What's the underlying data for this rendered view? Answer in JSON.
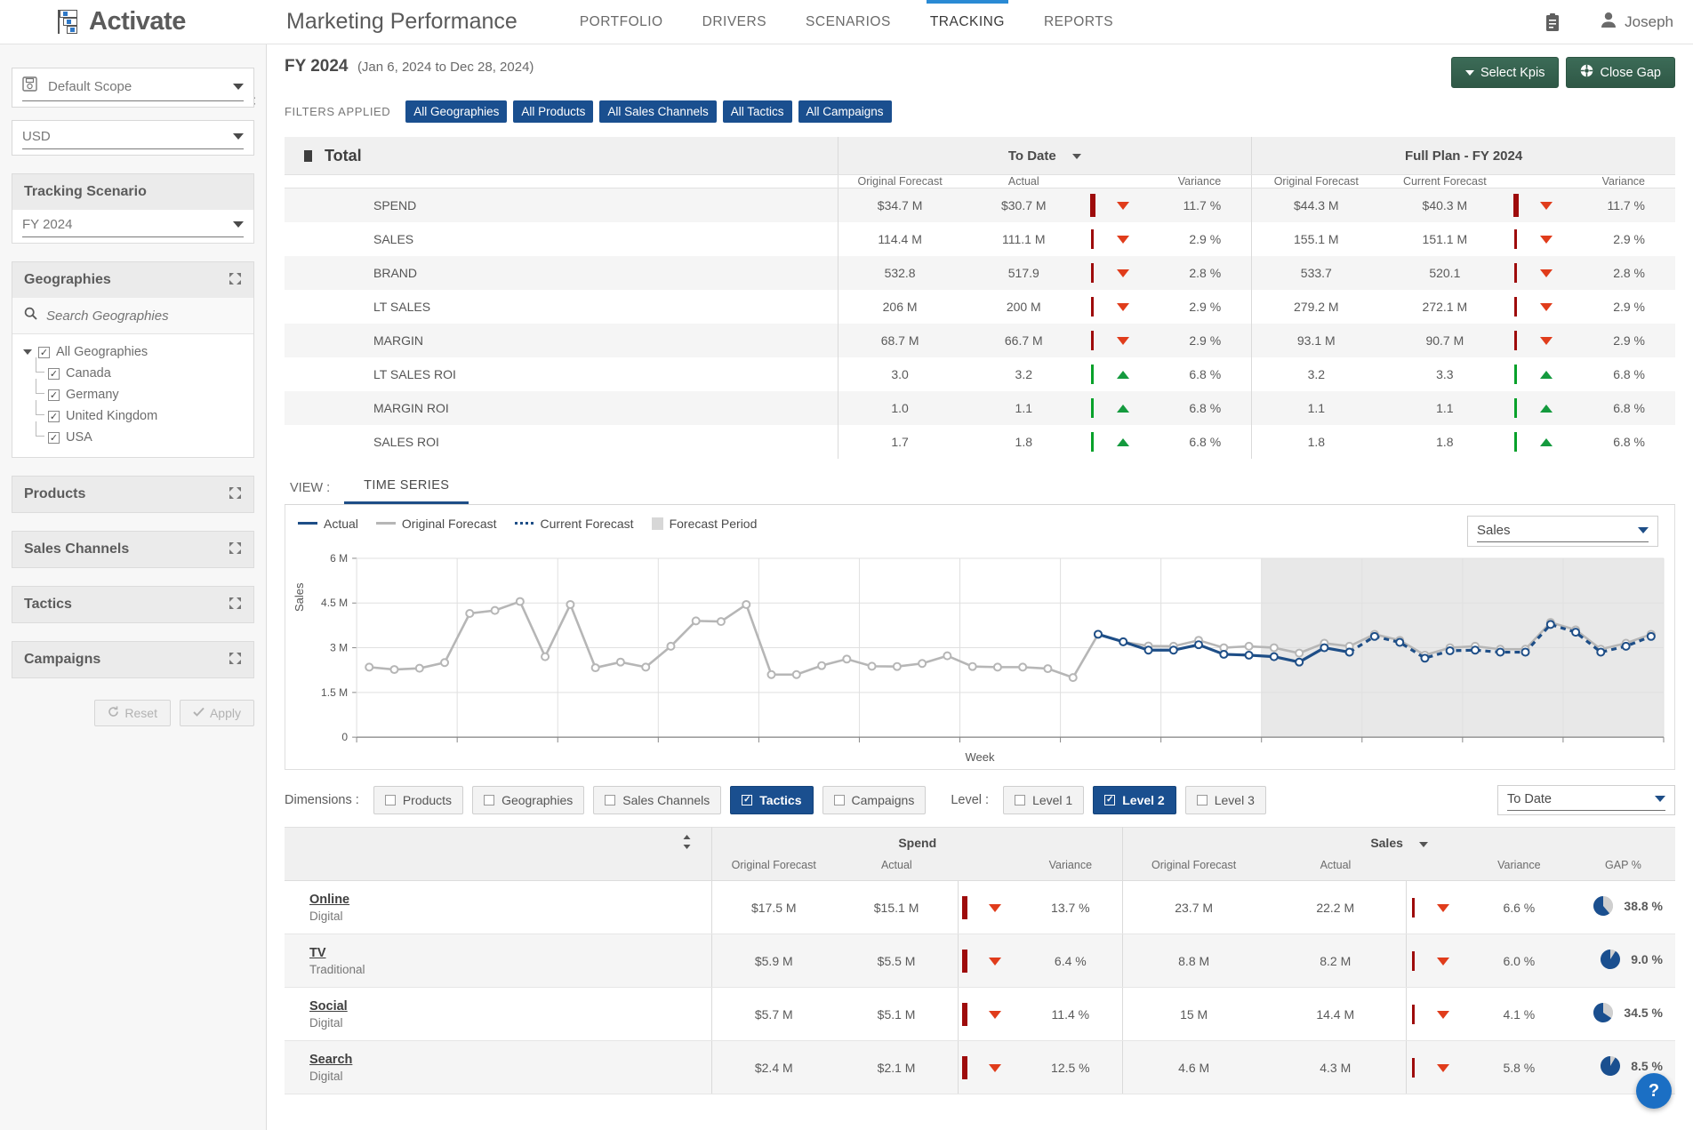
{
  "header": {
    "brand": "Activate",
    "app_title": "Marketing Performance",
    "nav": [
      {
        "label": "PORTFOLIO",
        "active": false
      },
      {
        "label": "DRIVERS",
        "active": false
      },
      {
        "label": "SCENARIOS",
        "active": false
      },
      {
        "label": "TRACKING",
        "active": true
      },
      {
        "label": "REPORTS",
        "active": false
      }
    ],
    "clipboard_icon": "clipboard-icon",
    "user_name": "Joseph",
    "user_icon": "user-icon"
  },
  "sidebar": {
    "close_icon": "close-icon",
    "scope": {
      "icon": "save-icon",
      "value": "Default Scope"
    },
    "currency": {
      "value": "USD"
    },
    "tracking_scenario": {
      "title": "Tracking Scenario",
      "value": "FY 2024"
    },
    "geographies": {
      "title": "Geographies",
      "search_placeholder": "Search Geographies",
      "root": "All Geographies",
      "children": [
        "Canada",
        "Germany",
        "United Kingdom",
        "USA"
      ]
    },
    "panels": [
      "Products",
      "Sales Channels",
      "Tactics",
      "Campaigns"
    ],
    "reset_label": "Reset",
    "apply_label": "Apply"
  },
  "page": {
    "title": "FY 2024",
    "subtitle": "(Jan 6, 2024 to Dec 28, 2024)",
    "select_kpis_label": "Select Kpis",
    "close_gap_label": "Close Gap",
    "filters_label": "FILTERS APPLIED",
    "filter_chips": [
      "All Geographies",
      "All Products",
      "All Sales Channels",
      "All Tactics",
      "All Campaigns"
    ]
  },
  "kpi_table": {
    "total_label": "Total",
    "group_to_date": "To Date",
    "group_full_plan": "Full Plan - FY 2024",
    "sub_headers": {
      "original_forecast": "Original Forecast",
      "actual": "Actual",
      "current_forecast": "Current Forecast",
      "variance": "Variance"
    },
    "rows": [
      {
        "name": "SPEND",
        "td_of": "$34.7 M",
        "td_actual": "$30.7 M",
        "td_var": "11.7 %",
        "td_dir": "down",
        "td_bar": "big",
        "fp_of": "$44.3 M",
        "fp_cf": "$40.3 M",
        "fp_var": "11.7 %",
        "fp_dir": "down",
        "fp_bar": "big"
      },
      {
        "name": "SALES",
        "td_of": "114.4 M",
        "td_actual": "111.1 M",
        "td_var": "2.9 %",
        "td_dir": "down",
        "td_bar": "small",
        "fp_of": "155.1 M",
        "fp_cf": "151.1 M",
        "fp_var": "2.9 %",
        "fp_dir": "down",
        "fp_bar": "small"
      },
      {
        "name": "BRAND",
        "td_of": "532.8",
        "td_actual": "517.9",
        "td_var": "2.8 %",
        "td_dir": "down",
        "td_bar": "small",
        "fp_of": "533.7",
        "fp_cf": "520.1",
        "fp_var": "2.8 %",
        "fp_dir": "down",
        "fp_bar": "small"
      },
      {
        "name": "LT SALES",
        "td_of": "206 M",
        "td_actual": "200 M",
        "td_var": "2.9 %",
        "td_dir": "down",
        "td_bar": "small",
        "fp_of": "279.2 M",
        "fp_cf": "272.1 M",
        "fp_var": "2.9 %",
        "fp_dir": "down",
        "fp_bar": "small"
      },
      {
        "name": "MARGIN",
        "td_of": "68.7 M",
        "td_actual": "66.7 M",
        "td_var": "2.9 %",
        "td_dir": "down",
        "td_bar": "small",
        "fp_of": "93.1 M",
        "fp_cf": "90.7 M",
        "fp_var": "2.9 %",
        "fp_dir": "down",
        "fp_bar": "small"
      },
      {
        "name": "LT SALES ROI",
        "td_of": "3.0",
        "td_actual": "3.2",
        "td_var": "6.8 %",
        "td_dir": "up",
        "td_bar": "mid",
        "fp_of": "3.2",
        "fp_cf": "3.3",
        "fp_var": "6.8 %",
        "fp_dir": "up",
        "fp_bar": "mid"
      },
      {
        "name": "MARGIN ROI",
        "td_of": "1.0",
        "td_actual": "1.1",
        "td_var": "6.8 %",
        "td_dir": "up",
        "td_bar": "mid",
        "fp_of": "1.1",
        "fp_cf": "1.1",
        "fp_var": "6.8 %",
        "fp_dir": "up",
        "fp_bar": "mid"
      },
      {
        "name": "SALES ROI",
        "td_of": "1.7",
        "td_actual": "1.8",
        "td_var": "6.8 %",
        "td_dir": "up",
        "td_bar": "mid",
        "fp_of": "1.8",
        "fp_cf": "1.8",
        "fp_var": "6.8 %",
        "fp_dir": "up",
        "fp_bar": "mid"
      }
    ]
  },
  "view": {
    "label": "VIEW :",
    "tab": "TIME SERIES",
    "kpi_selector_value": "Sales"
  },
  "chart_data": {
    "type": "line",
    "title": "",
    "xlabel": "Week",
    "ylabel": "Sales",
    "ylim": [
      0,
      6000000
    ],
    "ytick_labels": [
      "0",
      "1.5 M",
      "3 M",
      "4.5 M",
      "6 M"
    ],
    "ytick_values": [
      0,
      1500000,
      3000000,
      4500000,
      6000000
    ],
    "grid": true,
    "legend_position": "top-left",
    "forecast_period_start_index": 36,
    "legend": [
      {
        "name": "Actual",
        "color": "#1e4e87",
        "style": "solid"
      },
      {
        "name": "Original Forecast",
        "color": "#b6b6b6",
        "style": "solid"
      },
      {
        "name": "Current Forecast",
        "color": "#1e4e87",
        "style": "dotted"
      },
      {
        "name": "Forecast Period",
        "color": "#d7d7d7",
        "style": "band"
      }
    ],
    "x": [
      1,
      2,
      3,
      4,
      5,
      6,
      7,
      8,
      9,
      10,
      11,
      12,
      13,
      14,
      15,
      16,
      17,
      18,
      19,
      20,
      21,
      22,
      23,
      24,
      25,
      26,
      27,
      28,
      29,
      30,
      31,
      32,
      33,
      34,
      35,
      36,
      37,
      38,
      39,
      40,
      41,
      42,
      43,
      44,
      45,
      46,
      47,
      48,
      49,
      50,
      51,
      52
    ],
    "series": [
      {
        "name": "Original Forecast",
        "color": "#b6b6b6",
        "style": "solid",
        "values": [
          2.35,
          2.27,
          2.31,
          2.5,
          4.15,
          4.25,
          4.55,
          2.7,
          4.45,
          2.33,
          2.52,
          2.35,
          3.05,
          3.9,
          3.88,
          4.45,
          2.1,
          2.1,
          2.4,
          2.62,
          2.38,
          2.37,
          2.47,
          2.73,
          2.37,
          2.35,
          2.35,
          2.3,
          2.0,
          3.45,
          3.2,
          3.06,
          3.05,
          3.25,
          3.0,
          3.05,
          3.0,
          2.82,
          3.15,
          3.05,
          3.45,
          3.25,
          2.75,
          3.0,
          3.05,
          2.95,
          2.95,
          3.85,
          3.6,
          2.95,
          3.15,
          3.45
        ]
      },
      {
        "name": "Actual",
        "color": "#1e4e87",
        "style": "solid",
        "start_index": 29,
        "values": [
          null,
          null,
          null,
          null,
          null,
          null,
          null,
          null,
          null,
          null,
          null,
          null,
          null,
          null,
          null,
          null,
          null,
          null,
          null,
          null,
          null,
          null,
          null,
          null,
          null,
          null,
          null,
          null,
          null,
          3.45,
          3.2,
          2.92,
          2.92,
          3.1,
          2.78,
          2.75,
          2.7,
          2.52,
          3.0,
          2.85,
          null,
          null,
          null,
          null,
          null,
          null,
          null,
          null,
          null,
          null,
          null,
          null
        ]
      },
      {
        "name": "Current Forecast",
        "color": "#1e4e87",
        "style": "dotted",
        "start_index": 40,
        "values": [
          null,
          null,
          null,
          null,
          null,
          null,
          null,
          null,
          null,
          null,
          null,
          null,
          null,
          null,
          null,
          null,
          null,
          null,
          null,
          null,
          null,
          null,
          null,
          null,
          null,
          null,
          null,
          null,
          null,
          null,
          null,
          null,
          null,
          null,
          null,
          null,
          null,
          null,
          null,
          2.85,
          3.38,
          3.18,
          2.65,
          2.9,
          2.92,
          2.85,
          2.85,
          3.78,
          3.52,
          2.85,
          3.05,
          3.38
        ]
      }
    ]
  },
  "dimensions": {
    "label": "Dimensions :",
    "options": [
      {
        "label": "Products",
        "checked": false
      },
      {
        "label": "Geographies",
        "checked": false
      },
      {
        "label": "Sales Channels",
        "checked": false
      },
      {
        "label": "Tactics",
        "checked": true
      },
      {
        "label": "Campaigns",
        "checked": false
      }
    ],
    "level_label": "Level :",
    "levels": [
      {
        "label": "Level 1",
        "checked": false
      },
      {
        "label": "Level 2",
        "checked": true
      },
      {
        "label": "Level 3",
        "checked": false
      }
    ],
    "period_selector_value": "To Date"
  },
  "dim_table": {
    "group_spend": "Spend",
    "group_sales": "Sales",
    "sub_headers": {
      "original_forecast": "Original Forecast",
      "actual": "Actual",
      "variance": "Variance",
      "gap": "GAP %"
    },
    "rows": [
      {
        "name": "Online",
        "sub": "Digital",
        "sp_of": "$17.5 M",
        "sp_actual": "$15.1 M",
        "sp_var": "13.7 %",
        "sp_dir": "down",
        "sa_of": "23.7 M",
        "sa_actual": "22.2 M",
        "sa_var": "6.6 %",
        "sa_dir": "down",
        "gap": "38.8 %",
        "gap_value": 38.8
      },
      {
        "name": "TV",
        "sub": "Traditional",
        "sp_of": "$5.9 M",
        "sp_actual": "$5.5 M",
        "sp_var": "6.4 %",
        "sp_dir": "down",
        "sa_of": "8.8 M",
        "sa_actual": "8.2 M",
        "sa_var": "6.0 %",
        "sa_dir": "down",
        "gap": "9.0 %",
        "gap_value": 9.0
      },
      {
        "name": "Social",
        "sub": "Digital",
        "sp_of": "$5.7 M",
        "sp_actual": "$5.1 M",
        "sp_var": "11.4 %",
        "sp_dir": "down",
        "sa_of": "15 M",
        "sa_actual": "14.4 M",
        "sa_var": "4.1 %",
        "sa_dir": "down",
        "gap": "34.5 %",
        "gap_value": 34.5
      },
      {
        "name": "Search",
        "sub": "Digital",
        "sp_of": "$2.4 M",
        "sp_actual": "$2.1 M",
        "sp_var": "12.5 %",
        "sp_dir": "down",
        "sa_of": "4.6 M",
        "sa_actual": "4.3 M",
        "sa_var": "5.8 %",
        "sa_dir": "down",
        "gap": "8.5 %",
        "gap_value": 8.5
      }
    ]
  },
  "help": {
    "label": "?"
  },
  "colors": {
    "brand_blue": "#2a8ad4",
    "chip_blue": "#1a4f8f",
    "green_btn": "#2f5846",
    "down_red": "#e03c1b",
    "up_green": "#149a3e",
    "bar_red": "#9e0b0b",
    "bar_green": "#07a12a",
    "actual_line": "#1e4e87",
    "forecast_line": "#b6b6b6"
  }
}
